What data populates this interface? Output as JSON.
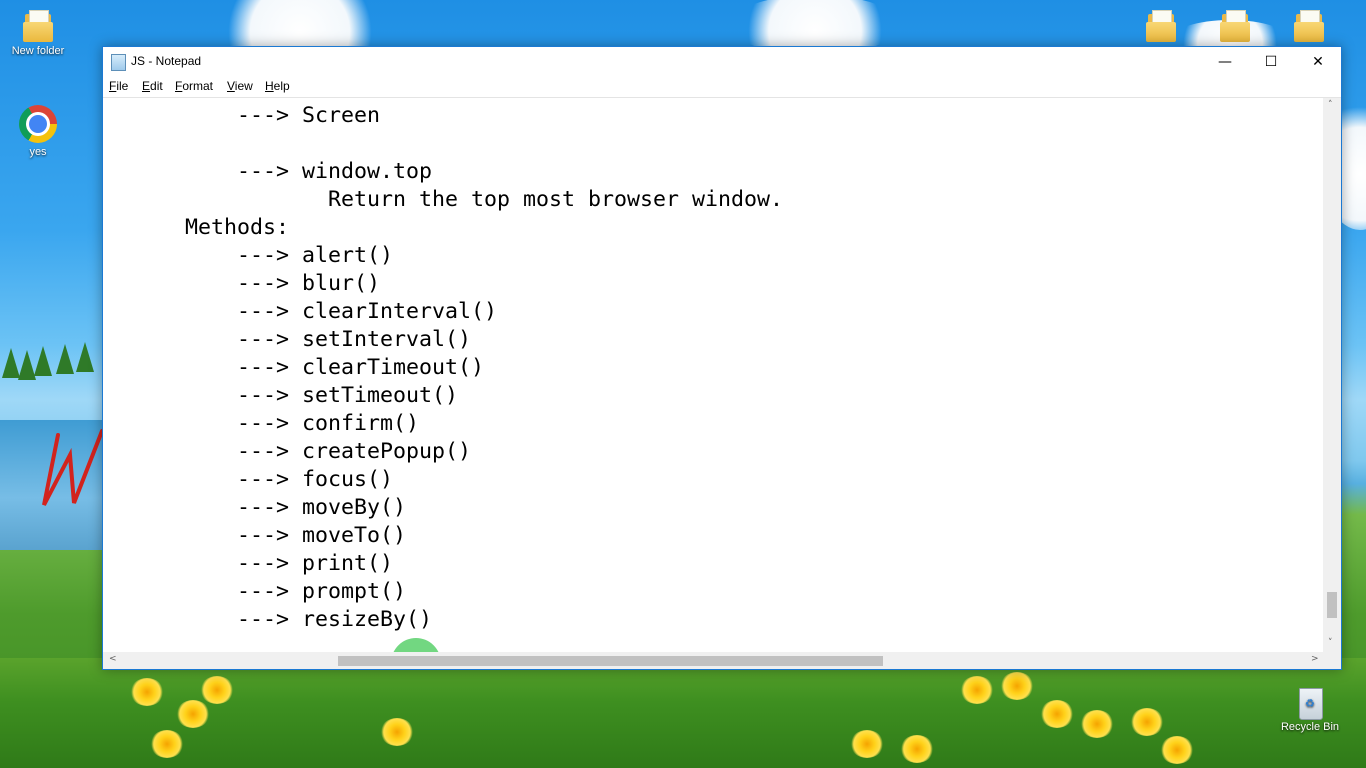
{
  "desktop": {
    "icons": {
      "new_folder": "New folder",
      "chrome": "yes",
      "recycle_bin": "Recycle Bin"
    }
  },
  "window": {
    "title": "JS - Notepad",
    "controls": {
      "minimize": "—",
      "maximize": "☐",
      "close": "✕"
    },
    "menu": [
      {
        "mnemonic": "F",
        "rest": "ile"
      },
      {
        "mnemonic": "E",
        "rest": "dit"
      },
      {
        "mnemonic": "F",
        "rest": "ormat"
      },
      {
        "mnemonic": "V",
        "rest": "iew"
      },
      {
        "mnemonic": "H",
        "rest": "elp"
      }
    ],
    "editor_text": "          ---> Screen\n\n          ---> window.top\n                 Return the top most browser window.\n      Methods:\n          ---> alert()\n          ---> blur()\n          ---> clearInterval()\n          ---> setInterval()\n          ---> clearTimeout()\n          ---> setTimeout()\n          ---> confirm()\n          ---> createPopup()\n          ---> focus()\n          ---> moveBy()\n          ---> moveTo()\n          ---> print()\n          ---> prompt()\n          ---> resizeBy()",
    "scrollbars": {
      "up_arrow": "˄",
      "down_arrow": "˅",
      "left_arrow": "<",
      "right_arrow": ">"
    },
    "cursor_glyph": "I"
  }
}
